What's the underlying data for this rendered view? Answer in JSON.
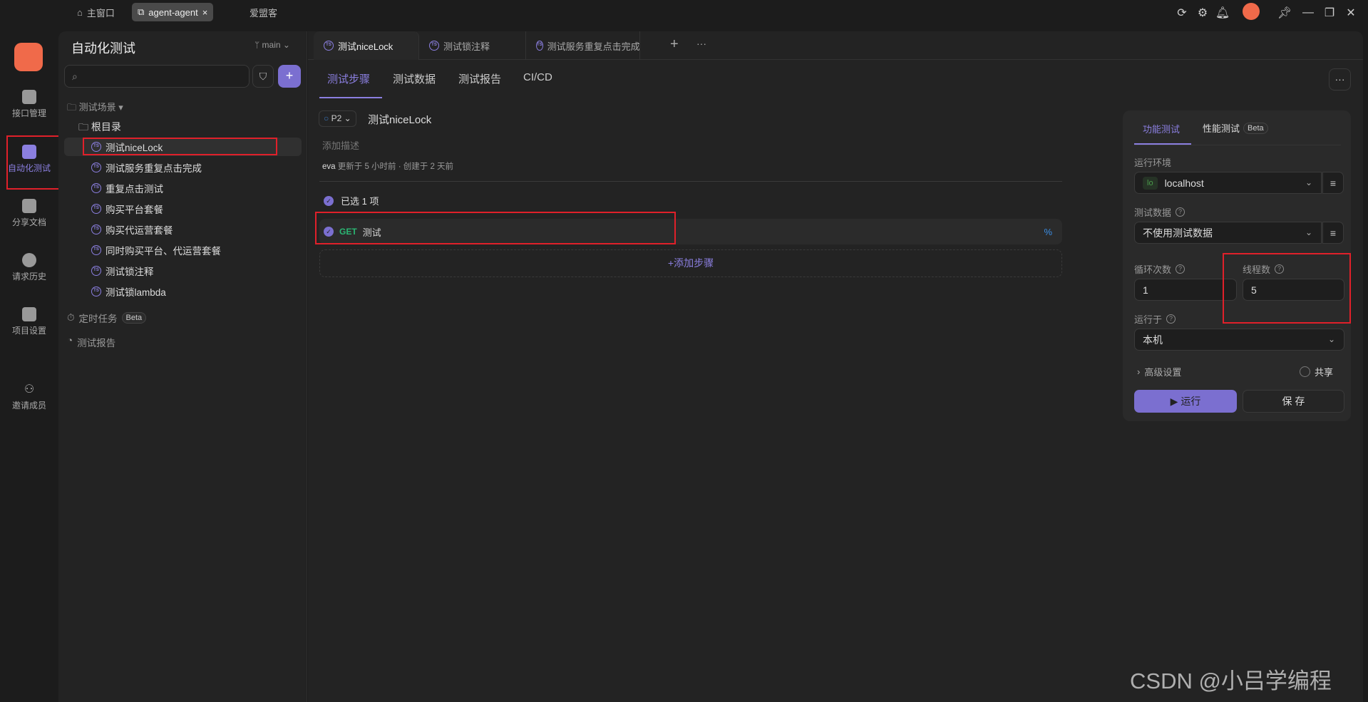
{
  "topbar": {
    "home": "主窗口",
    "project_tab": "agent-agent",
    "other_tab": "爱盟客",
    "icons": [
      "refresh-icon",
      "settings-icon",
      "bell-icon",
      "avatar",
      "pin-icon",
      "minimize-icon",
      "restore-icon",
      "close-icon"
    ]
  },
  "rail": {
    "items": [
      {
        "label": "接口管理",
        "icon": "api-icon"
      },
      {
        "label": "自动化测试",
        "icon": "automation-icon"
      },
      {
        "label": "分享文档",
        "icon": "share-doc-icon"
      },
      {
        "label": "请求历史",
        "icon": "history-icon"
      },
      {
        "label": "项目设置",
        "icon": "project-settings-icon"
      },
      {
        "label": "邀请成员",
        "icon": "invite-icon"
      }
    ]
  },
  "sidebar": {
    "title": "自动化测试",
    "branch": "main",
    "scenes_label": "测试场景",
    "root": "根目录",
    "items": [
      "测试niceLock",
      "测试服务重复点击完成",
      "重复点击测试",
      "购买平台套餐",
      "购买代运营套餐",
      "同时购买平台、代运营套餐",
      "测试锁注释",
      "测试锁lambda"
    ],
    "scheduled": "定时任务",
    "beta": "Beta",
    "reports": "测试报告"
  },
  "file_tabs": [
    "测试niceLock",
    "测试锁注释",
    "测试服务重复点击完成"
  ],
  "subtabs": [
    "测试步骤",
    "测试数据",
    "测试报告",
    "CI/CD"
  ],
  "scenario": {
    "priority": "P2",
    "name": "测试niceLock",
    "desc_placeholder": "添加描述",
    "author": "eva",
    "meta": "更新于 5 小时前 · 创建于 2 天前",
    "selected": "已选 1 项",
    "step_method": "GET",
    "step_name": "测试",
    "add_step": "+添加步骤"
  },
  "panel": {
    "tabs": [
      "功能测试",
      "性能测试"
    ],
    "beta": "Beta",
    "env_label": "运行环境",
    "env_badge": "lo",
    "env_value": "localhost",
    "data_label": "测试数据",
    "data_value": "不使用测试数据",
    "loop_label": "循环次数",
    "loop_value": "1",
    "thread_label": "线程数",
    "thread_value": "5",
    "runon_label": "运行于",
    "runon_value": "本机",
    "advanced": "高级设置",
    "share": "共享",
    "run": "▶ 运行",
    "save": "保 存"
  },
  "watermark": "CSDN @小吕学编程",
  "colors": {
    "accent": "#8b7fe0",
    "get": "#2bb673",
    "annotation": "#e0202a"
  }
}
